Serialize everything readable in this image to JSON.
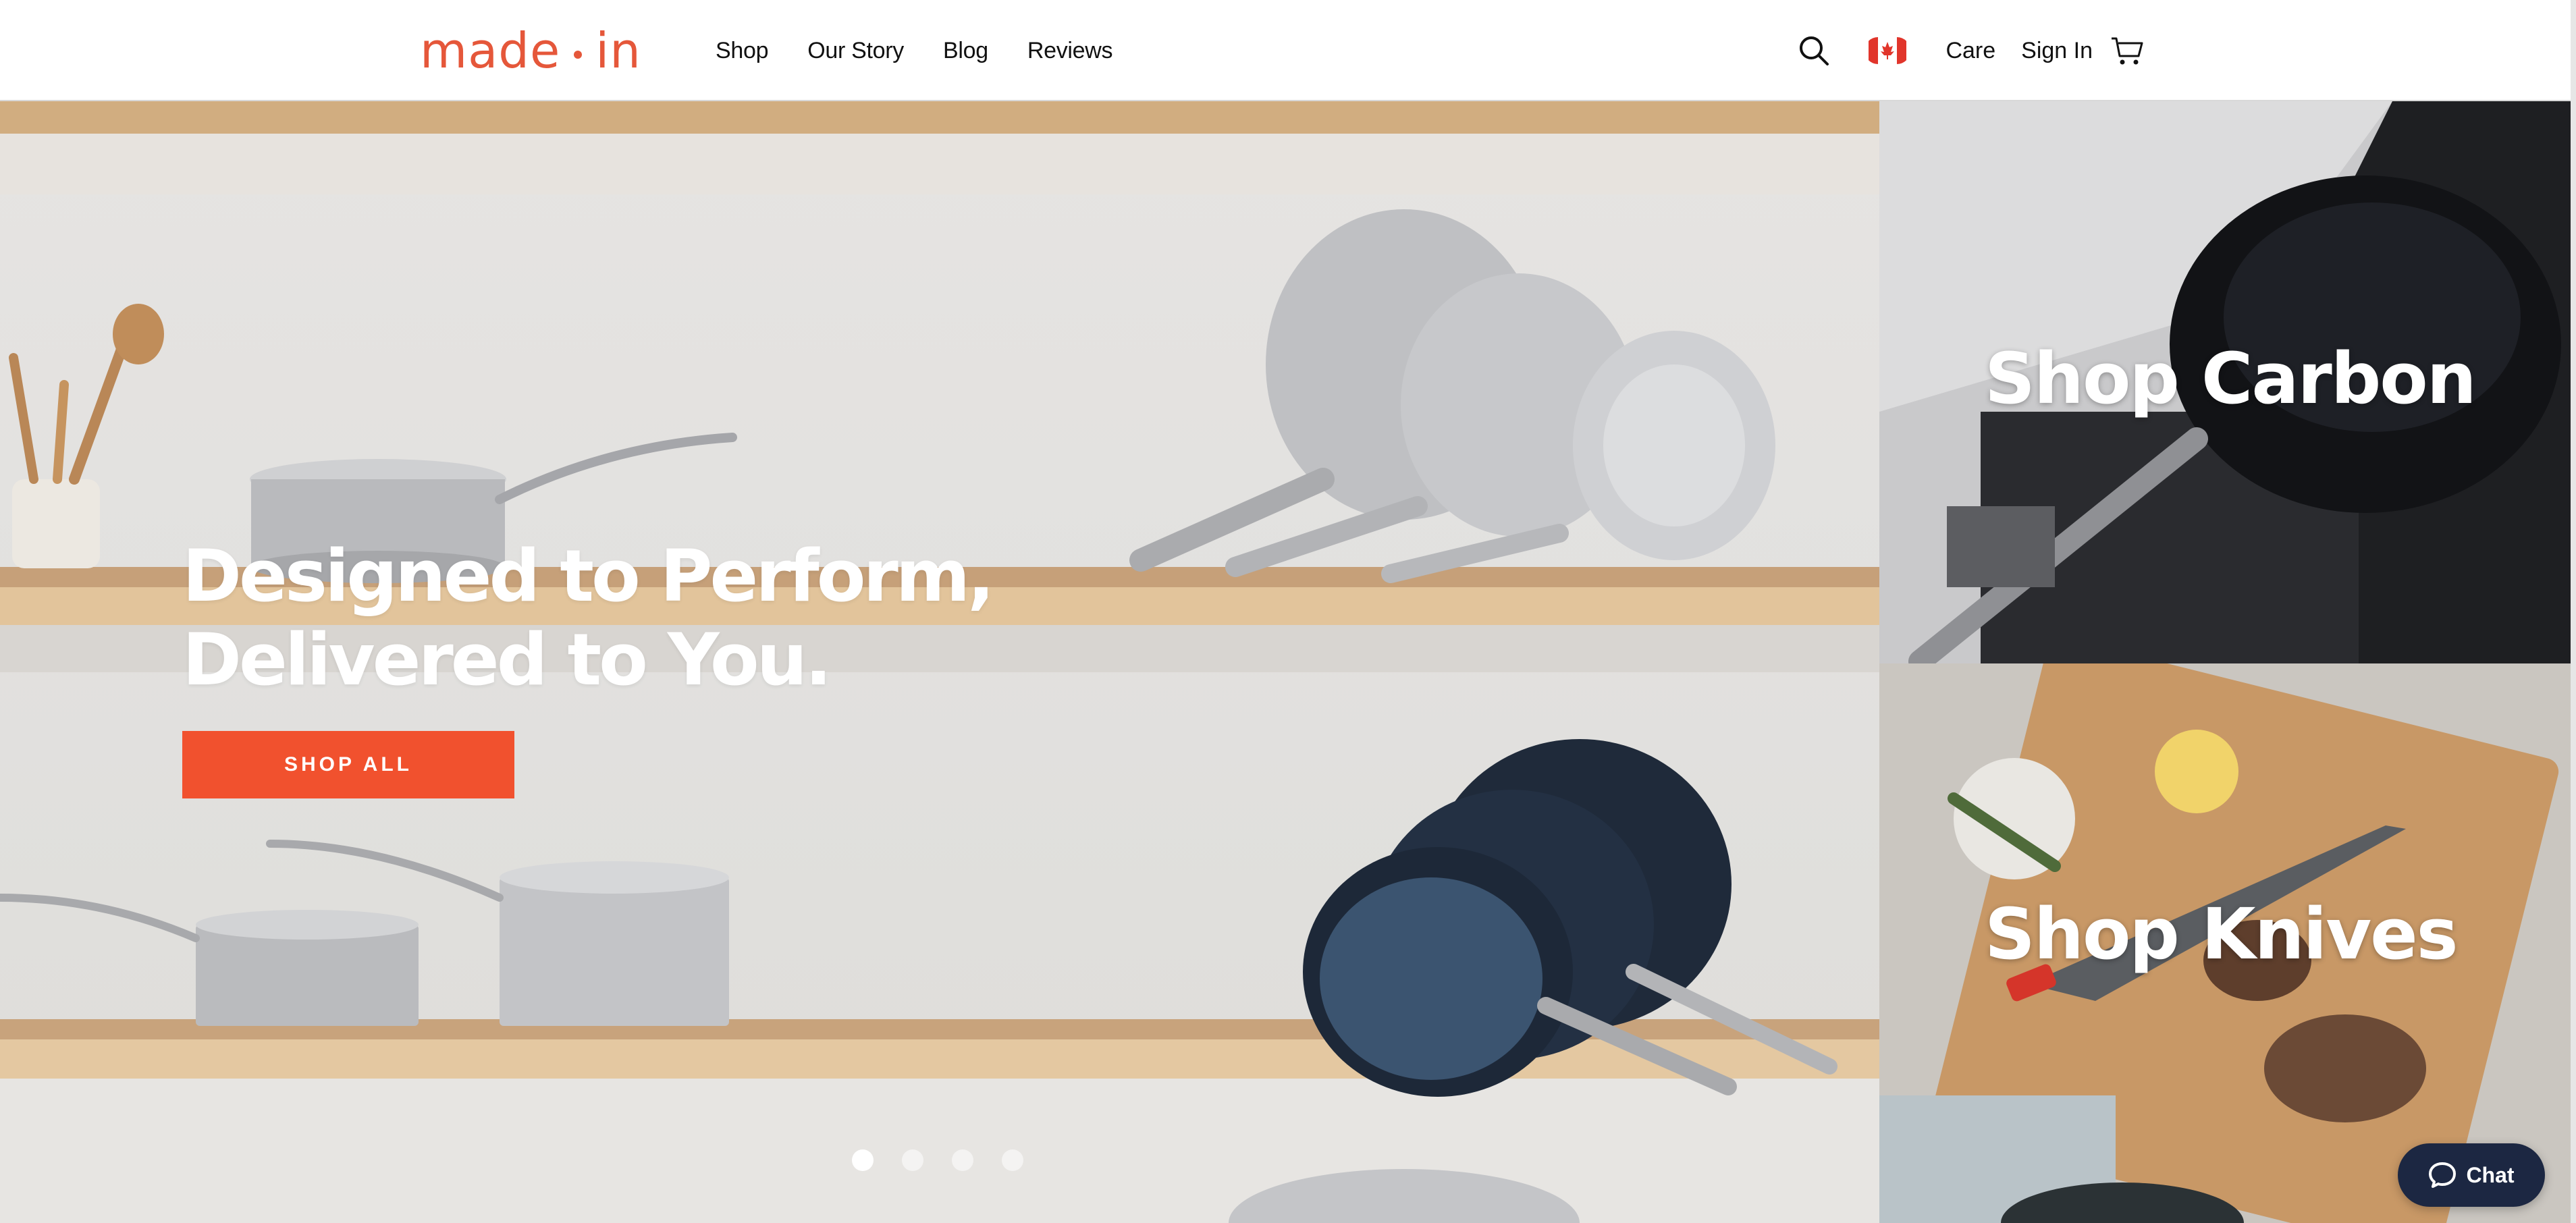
{
  "header": {
    "logo_left": "made",
    "logo_right": "in",
    "nav": [
      "Shop",
      "Our Story",
      "Blog",
      "Reviews"
    ],
    "care": "Care",
    "sign_in": "Sign In"
  },
  "hero": {
    "headline_line1": "Designed to Perform,",
    "headline_line2": "Delivered to You.",
    "cta": "SHOP ALL",
    "slides_total": 4,
    "active_slide": 1
  },
  "tiles": {
    "carbon_label": "Shop Carbon",
    "knives_label": "Shop Knives"
  },
  "chat": {
    "label": "Chat"
  },
  "colors": {
    "brand": "#e5573a",
    "cta": "#f1512e",
    "chat_bg": "#1c2742"
  }
}
